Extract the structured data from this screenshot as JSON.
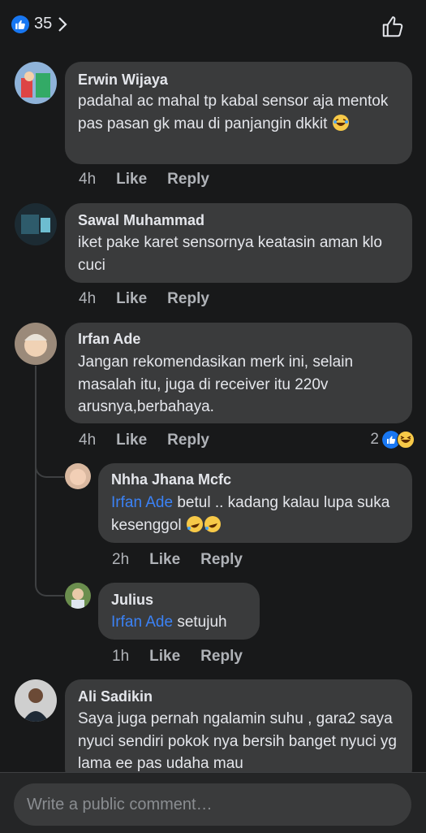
{
  "header": {
    "reaction_count": "35"
  },
  "comments": [
    {
      "author": "Erwin Wijaya",
      "text": "padahal ac mahal tp kabal sensor aja mentok pas pasan gk mau di panjangin dkkit",
      "time": "4h",
      "like": "Like",
      "reply": "Reply"
    },
    {
      "author": "Sawal Muhammad",
      "text": "iket pake karet sensornya keatasin aman klo cuci",
      "time": "4h",
      "like": "Like",
      "reply": "Reply"
    },
    {
      "author": "Irfan Ade",
      "text": "Jangan rekomendasikan merk ini, selain masalah itu, juga di receiver itu 220v arusnya,berbahaya.",
      "time": "4h",
      "like": "Like",
      "reply": "Reply",
      "reaction_count": "2"
    },
    {
      "author": "Nhha Jhana Mcfc",
      "mention": "Irfan Ade",
      "text": " betul .. kadang kalau lupa suka kesenggol",
      "time": "2h",
      "like": "Like",
      "reply": "Reply"
    },
    {
      "author": "Julius",
      "mention": "Irfan Ade",
      "text": " setujuh",
      "time": "1h",
      "like": "Like",
      "reply": "Reply"
    },
    {
      "author": "Ali Sadikin",
      "text": "Saya juga pernah ngalamin suhu , gara2 saya nyuci sendiri pokok nya bersih banget nyuci yg lama ee pas udaha mau",
      "time": "",
      "like": "",
      "reply": ""
    }
  ],
  "composer": {
    "placeholder": "Write a public comment…"
  }
}
